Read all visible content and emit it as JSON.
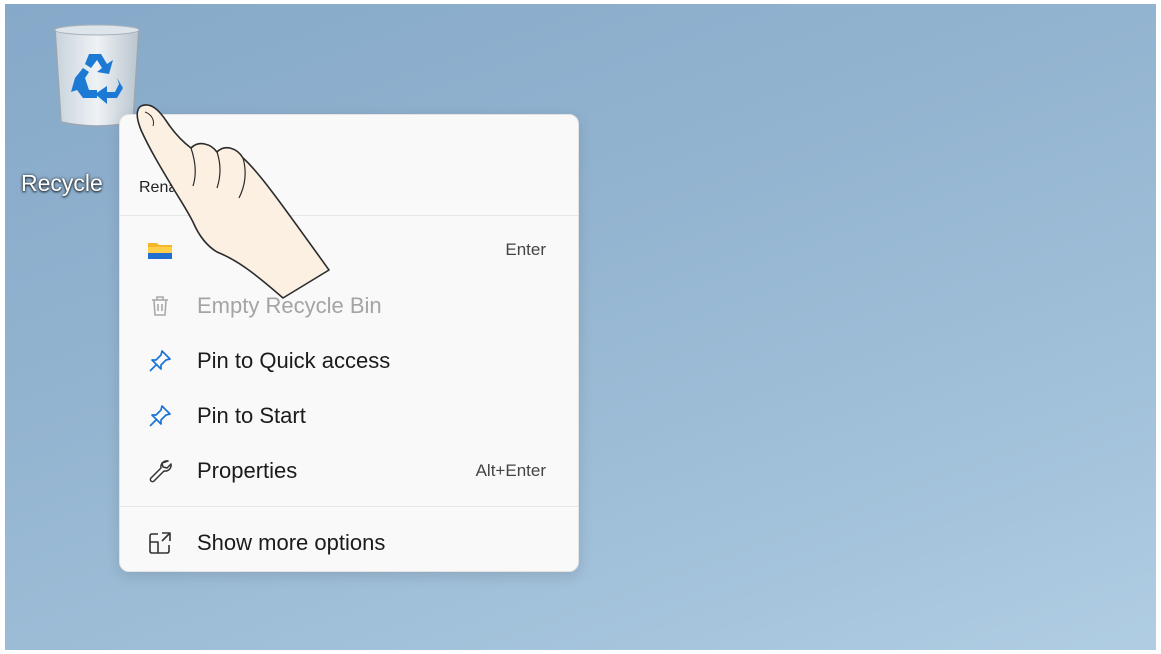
{
  "desktop": {
    "recycle_bin_label": "Recycle"
  },
  "context_menu": {
    "rename_label": "Rena",
    "items": [
      {
        "label": "",
        "shortcut": "Enter",
        "icon": "folder-icon",
        "disabled": false
      },
      {
        "label": "Empty Recycle Bin",
        "shortcut": "",
        "icon": "trash-icon",
        "disabled": true
      },
      {
        "label": "Pin to Quick access",
        "shortcut": "",
        "icon": "pin-icon",
        "disabled": false
      },
      {
        "label": "Pin to Start",
        "shortcut": "",
        "icon": "pin-icon",
        "disabled": false
      },
      {
        "label": "Properties",
        "shortcut": "Alt+Enter",
        "icon": "wrench-icon",
        "disabled": false
      },
      {
        "label": "Show more options",
        "shortcut": "",
        "icon": "share-icon",
        "disabled": false
      }
    ]
  },
  "colors": {
    "desktop_bg": "#93b4d0",
    "menu_bg": "#f9f9f9",
    "accent_blue": "#1a73d6",
    "disabled_text": "#a4a4a4"
  }
}
